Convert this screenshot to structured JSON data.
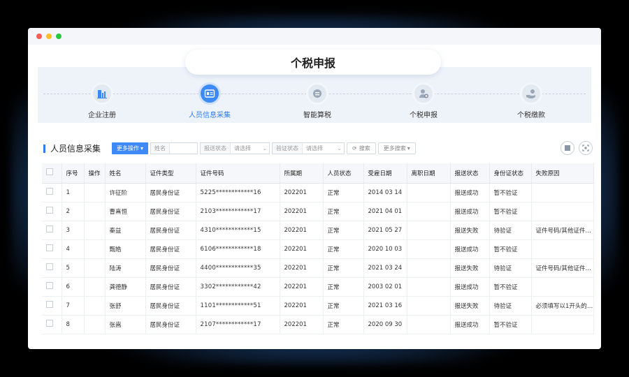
{
  "app": {
    "title": "个税申报"
  },
  "steps": [
    {
      "label": "企业注册",
      "icon": "building-chart-icon",
      "active": false
    },
    {
      "label": "人员信息采集",
      "icon": "id-card-icon",
      "active": true
    },
    {
      "label": "智能算税",
      "icon": "calculator-badge-icon",
      "active": false
    },
    {
      "label": "个税申报",
      "icon": "user-plus-icon",
      "active": false
    },
    {
      "label": "个税缴款",
      "icon": "hand-coin-icon",
      "active": false
    }
  ],
  "section": {
    "title": "人员信息采集"
  },
  "toolbar": {
    "more_ops": "更多操作",
    "name_label": "姓名",
    "name_value": "",
    "report_status_label": "报送状态",
    "report_status_value": "请选择",
    "verify_status_label": "验证状态",
    "verify_status_value": "请选择",
    "search_label": "搜索",
    "more_search_label": "更多搜索"
  },
  "table": {
    "headers": [
      "",
      "序号",
      "操作",
      "姓名",
      "证件类型",
      "证件号码",
      "所属期",
      "人员状态",
      "受雇日期",
      "离职日期",
      "报送状态",
      "身份证状态",
      "失败原因"
    ],
    "rows": [
      {
        "no": "1",
        "name": "许征阶",
        "id_type": "居民身份证",
        "id_no": "5225************16",
        "period": "202201",
        "status": "正常",
        "hire_date": "2014 03 14",
        "leave_date": "",
        "report": "报送成功",
        "verify": "暂不验证",
        "reason": ""
      },
      {
        "no": "2",
        "name": "曹熹恒",
        "id_type": "居民身份证",
        "id_no": "2103************17",
        "period": "202201",
        "status": "正常",
        "hire_date": "2021 04 01",
        "leave_date": "",
        "report": "报送成功",
        "verify": "暂不验证",
        "reason": ""
      },
      {
        "no": "3",
        "name": "秦益",
        "id_type": "居民身份证",
        "id_no": "4310************15",
        "period": "202201",
        "status": "正常",
        "hire_date": "2021 05 27",
        "leave_date": "",
        "report": "报送失败",
        "verify": "待验证",
        "reason": "证件号码/其他证件…"
      },
      {
        "no": "4",
        "name": "甄皓",
        "id_type": "居民身份证",
        "id_no": "6106************18",
        "period": "202201",
        "status": "正常",
        "hire_date": "2020 10 03",
        "leave_date": "",
        "report": "报送成功",
        "verify": "暂不验证",
        "reason": ""
      },
      {
        "no": "5",
        "name": "陆涛",
        "id_type": "居民身份证",
        "id_no": "4400************35",
        "period": "202201",
        "status": "正常",
        "hire_date": "2021 03 24",
        "leave_date": "",
        "report": "报送失败",
        "verify": "待验证",
        "reason": "证件号码/其他证件…"
      },
      {
        "no": "6",
        "name": "龚德静",
        "id_type": "居民身份证",
        "id_no": "3302************42",
        "period": "202201",
        "status": "正常",
        "hire_date": "2003 02 01",
        "leave_date": "",
        "report": "报送成功",
        "verify": "暂不验证",
        "reason": ""
      },
      {
        "no": "7",
        "name": "张舒",
        "id_type": "居民身份证",
        "id_no": "1101************51",
        "period": "202201",
        "status": "正常",
        "hire_date": "2021 03 16",
        "leave_date": "",
        "report": "报送失败",
        "verify": "待验证",
        "reason": "必须填写以1开头的…"
      },
      {
        "no": "8",
        "name": "张嵩",
        "id_type": "居民身份证",
        "id_no": "2107************17",
        "period": "202201",
        "status": "正常",
        "hire_date": "2020 09 30",
        "leave_date": "",
        "report": "报送成功",
        "verify": "暂不验证",
        "reason": ""
      }
    ]
  },
  "colors": {
    "accent": "#3d8af7",
    "band": "#eef3f9",
    "dot_red": "#ff5f57",
    "dot_yellow": "#febc2e",
    "dot_green": "#28c840"
  }
}
